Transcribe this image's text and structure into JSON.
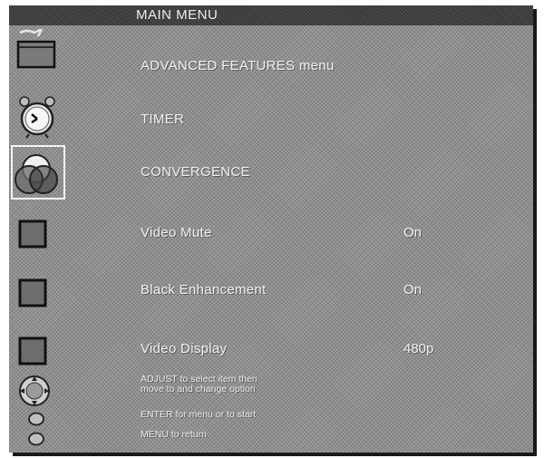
{
  "menu": {
    "title": "MAIN MENU",
    "items": [
      {
        "label": "ADVANCED FEATURES menu",
        "value": "",
        "icon": "folder-arrow-icon"
      },
      {
        "label": "TIMER",
        "value": "",
        "icon": "alarm-clock-icon"
      },
      {
        "label": "CONVERGENCE",
        "value": "",
        "icon": "color-circles-icon",
        "selected": true
      },
      {
        "label": "Video Mute",
        "value": "On",
        "icon": "checkbox-icon"
      },
      {
        "label": "Black Enhancement",
        "value": "On",
        "icon": "checkbox-icon"
      },
      {
        "label": "Video Display",
        "value": "480p",
        "icon": "checkbox-icon"
      }
    ]
  },
  "help": {
    "adjust_line1": "ADJUST to select item then",
    "adjust_line2": "move to and change option",
    "enter": "ENTER for menu or to start",
    "menu": "MENU to return",
    "icons": [
      "joystick-icon",
      "enter-button-icon",
      "menu-button-icon"
    ]
  },
  "colors": {
    "background": "#8f8f8f",
    "title_bar": "#3a3a3a",
    "text": "#f2f2f2"
  }
}
